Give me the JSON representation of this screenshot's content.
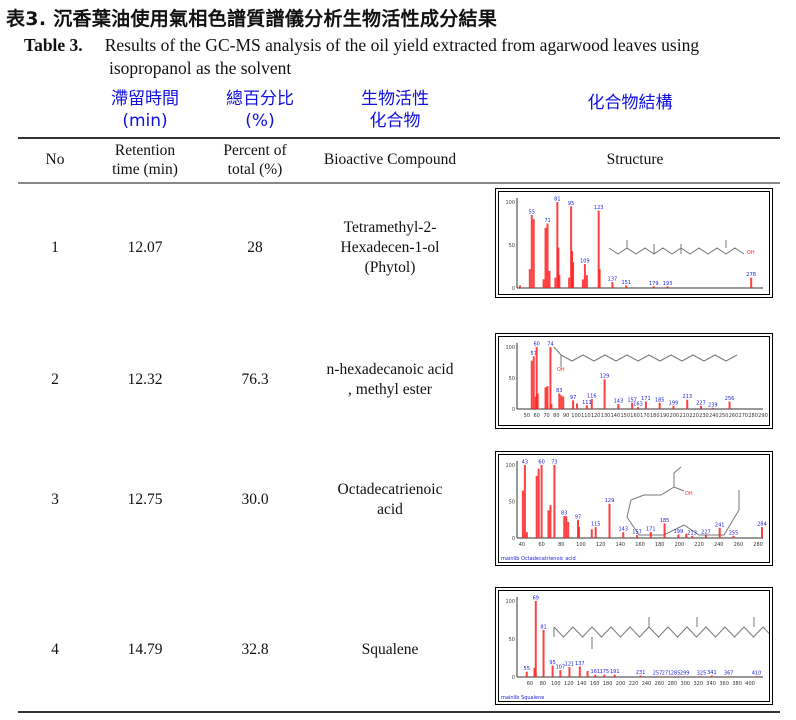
{
  "title": "表3. 沉香葉油使用氣相色譜質譜儀分析生物活性成分結果",
  "caption": {
    "label": "Table 3.",
    "line1": "Results of the GC-MS analysis of the oil yield extracted from agarwood leaves using",
    "line2": "isopropanol as the solvent"
  },
  "chinese_headers": {
    "retention": [
      "滯留時間",
      "(min)"
    ],
    "percent": [
      "總百分比",
      "(%)"
    ],
    "compound": [
      "生物活性",
      "化合物"
    ],
    "structure": "化合物結構"
  },
  "headers": {
    "no": "No",
    "retention": [
      "Retention",
      "time (min)"
    ],
    "percent": [
      "Percent of",
      "total (%)"
    ],
    "compound": "Bioactive Compound",
    "structure": "Structure"
  },
  "rows": [
    {
      "no": "1",
      "retention": "12.07",
      "percent": "28",
      "compound": [
        "Tetramethyl-2-",
        "Hexadecen-1-ol",
        "(Phytol)"
      ]
    },
    {
      "no": "2",
      "retention": "12.32",
      "percent": "76.3",
      "compound": [
        "n-hexadecanoic acid",
        ", methyl ester"
      ]
    },
    {
      "no": "3",
      "retention": "12.75",
      "percent": "30.0",
      "compound": [
        "Octadecatrienoic",
        "acid"
      ]
    },
    {
      "no": "4",
      "retention": "14.79",
      "percent": "32.8",
      "compound": [
        "Squalene"
      ]
    }
  ],
  "chart_data": [
    {
      "type": "bar",
      "xlim": [
        40,
        290
      ],
      "ylim": [
        0,
        100
      ],
      "y_ticks": [
        "100",
        "50",
        "0"
      ],
      "x_ticks": [],
      "caption": "",
      "structure_label": "OH",
      "peaks": [
        [
          43,
          3
        ],
        [
          53,
          22
        ],
        [
          55,
          85,
          "55"
        ],
        [
          57,
          80
        ],
        [
          67,
          10
        ],
        [
          69,
          70
        ],
        [
          71,
          75,
          "71"
        ],
        [
          73,
          20
        ],
        [
          79,
          12
        ],
        [
          81,
          100,
          "81"
        ],
        [
          82,
          47
        ],
        [
          83,
          15
        ],
        [
          93,
          12
        ],
        [
          95,
          95,
          "95"
        ],
        [
          96,
          43
        ],
        [
          97,
          30
        ],
        [
          107,
          10
        ],
        [
          109,
          28,
          "109"
        ],
        [
          111,
          15
        ],
        [
          123,
          90,
          "123"
        ],
        [
          124,
          22
        ],
        [
          137,
          7,
          "137"
        ],
        [
          151,
          3,
          "151"
        ],
        [
          179,
          2,
          "179"
        ],
        [
          193,
          2,
          "193"
        ],
        [
          278,
          12,
          "278"
        ]
      ]
    },
    {
      "type": "bar",
      "xlim": [
        40,
        290
      ],
      "ylim": [
        0,
        100
      ],
      "y_ticks": [
        "100",
        "50",
        "0"
      ],
      "x_ticks": [
        "50",
        "60",
        "70",
        "80",
        "90",
        "100",
        "110",
        "120",
        "130",
        "140",
        "150",
        "160",
        "170",
        "180",
        "190",
        "200",
        "210",
        "220",
        "230",
        "240",
        "250",
        "260",
        "270",
        "280",
        "290"
      ],
      "caption": "",
      "structure_label": "OH",
      "peaks": [
        [
          55,
          78
        ],
        [
          57,
          85,
          "57"
        ],
        [
          59,
          20
        ],
        [
          60,
          100,
          "60"
        ],
        [
          61,
          25
        ],
        [
          69,
          35
        ],
        [
          71,
          37
        ],
        [
          74,
          100,
          "74"
        ],
        [
          75,
          8
        ],
        [
          83,
          25,
          "83"
        ],
        [
          85,
          22
        ],
        [
          87,
          20
        ],
        [
          97,
          14,
          "97"
        ],
        [
          101,
          9
        ],
        [
          111,
          6,
          "111"
        ],
        [
          116,
          16,
          "116"
        ],
        [
          129,
          48,
          "129"
        ],
        [
          143,
          8,
          "143"
        ],
        [
          157,
          10,
          "157"
        ],
        [
          163,
          3,
          "163"
        ],
        [
          171,
          12,
          "171"
        ],
        [
          185,
          10,
          "185"
        ],
        [
          199,
          5,
          "199"
        ],
        [
          213,
          15,
          "213"
        ],
        [
          227,
          5,
          "227"
        ],
        [
          239,
          2,
          "239"
        ],
        [
          256,
          12,
          "256"
        ]
      ]
    },
    {
      "type": "bar",
      "xlim": [
        35,
        285
      ],
      "ylim": [
        0,
        100
      ],
      "y_ticks": [
        "100",
        "50",
        "0"
      ],
      "x_ticks": [
        "40",
        "60",
        "80",
        "100",
        "120",
        "140",
        "160",
        "180",
        "200",
        "220",
        "240",
        "260",
        "280"
      ],
      "caption": "mainlib Octadecatrienoic acid",
      "structure_label": "OH",
      "peaks": [
        [
          41,
          65
        ],
        [
          43,
          100,
          "43"
        ],
        [
          45,
          8
        ],
        [
          55,
          85
        ],
        [
          57,
          95
        ],
        [
          60,
          100,
          "60"
        ],
        [
          67,
          38
        ],
        [
          69,
          45
        ],
        [
          73,
          100,
          "73"
        ],
        [
          83,
          30,
          "83"
        ],
        [
          85,
          30
        ],
        [
          87,
          22
        ],
        [
          97,
          25,
          "97"
        ],
        [
          98,
          15
        ],
        [
          111,
          12
        ],
        [
          115,
          15,
          "115"
        ],
        [
          129,
          47,
          "129"
        ],
        [
          143,
          8,
          "143"
        ],
        [
          157,
          4,
          "157"
        ],
        [
          171,
          8,
          "171"
        ],
        [
          185,
          20,
          "185"
        ],
        [
          199,
          5,
          "199"
        ],
        [
          207,
          6
        ],
        [
          213,
          3,
          "213"
        ],
        [
          227,
          4,
          "227"
        ],
        [
          241,
          14,
          "241"
        ],
        [
          255,
          3,
          "255"
        ],
        [
          284,
          15,
          "284"
        ]
      ]
    },
    {
      "type": "bar",
      "xlim": [
        40,
        420
      ],
      "ylim": [
        0,
        100
      ],
      "y_ticks": [
        "100",
        "50",
        "0"
      ],
      "x_ticks": [
        "60",
        "80",
        "100",
        "120",
        "140",
        "160",
        "180",
        "200",
        "220",
        "240",
        "260",
        "280",
        "300",
        "320",
        "340",
        "360",
        "380",
        "400"
      ],
      "caption": "mainlib Squalene",
      "structure_label": "",
      "peaks": [
        [
          55,
          7,
          "55"
        ],
        [
          67,
          12
        ],
        [
          69,
          100,
          "69"
        ],
        [
          81,
          62,
          "81"
        ],
        [
          95,
          15,
          "95"
        ],
        [
          107,
          9,
          "107"
        ],
        [
          121,
          13,
          "121"
        ],
        [
          137,
          14,
          "137"
        ],
        [
          149,
          8
        ],
        [
          161,
          3,
          "161"
        ],
        [
          175,
          3,
          "175"
        ],
        [
          191,
          3,
          "191"
        ],
        [
          231,
          2,
          "231"
        ],
        [
          257,
          1,
          "257"
        ],
        [
          271,
          1,
          "271"
        ],
        [
          285,
          1,
          "285"
        ],
        [
          299,
          1,
          "299"
        ],
        [
          325,
          1,
          "325"
        ],
        [
          341,
          2,
          "341"
        ],
        [
          367,
          1,
          "367"
        ],
        [
          410,
          1,
          "410"
        ]
      ]
    }
  ],
  "colors": {
    "peak": "#ff2020",
    "label": "#2020e0",
    "title_blue": "#1010e0"
  }
}
